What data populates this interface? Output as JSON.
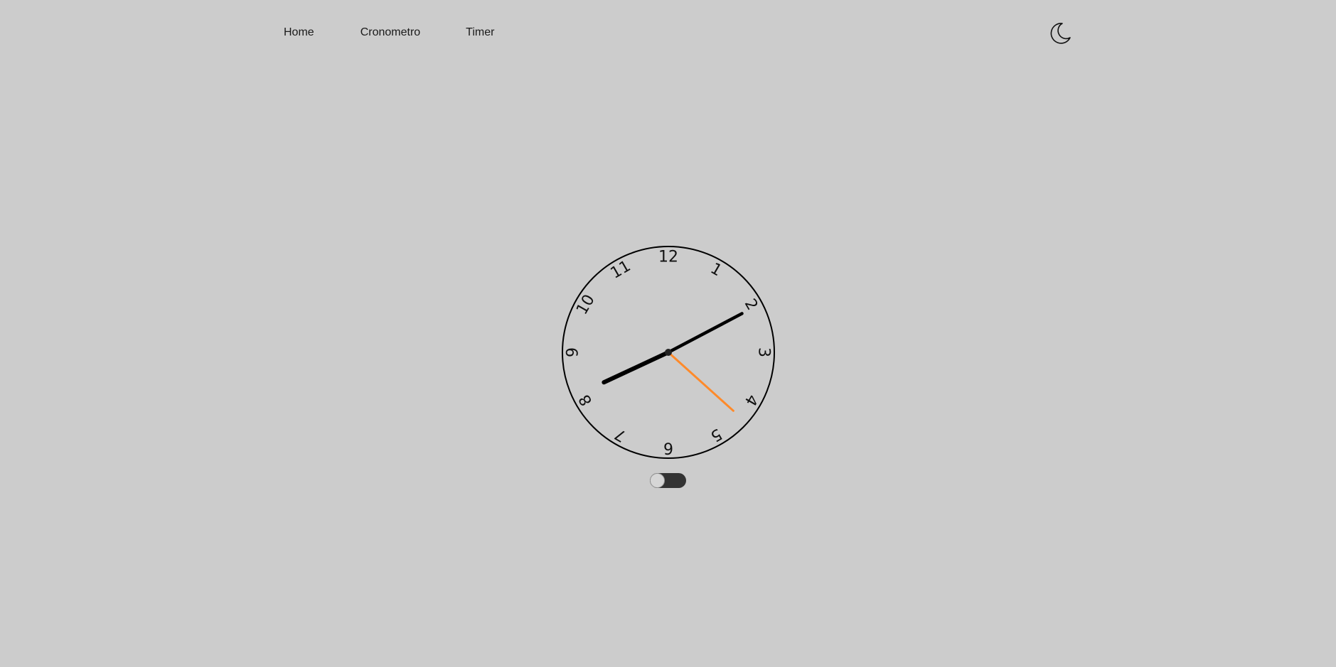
{
  "nav": {
    "items": [
      {
        "label": "Home"
      },
      {
        "label": "Cronometro"
      },
      {
        "label": "Timer"
      }
    ]
  },
  "theme_toggle": {
    "icon": "moon-icon"
  },
  "clock": {
    "numbers": [
      "12",
      "1",
      "2",
      "3",
      "4",
      "5",
      "6",
      "7",
      "8",
      "9",
      "10",
      "11"
    ],
    "time": {
      "hour": 8,
      "minute": 10,
      "second": 22
    },
    "colors": {
      "face_stroke": "#000000",
      "hour_hand": "#000000",
      "minute_hand": "#000000",
      "second_hand": "#ff8a2a",
      "center": "#222222"
    }
  },
  "switch": {
    "state": "off"
  }
}
